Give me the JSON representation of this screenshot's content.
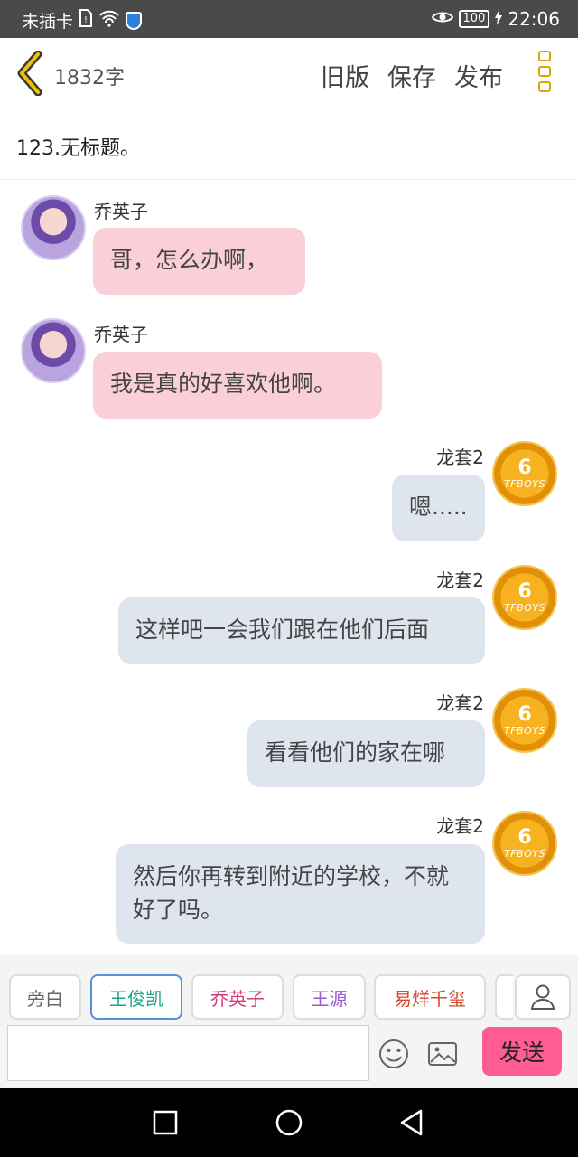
{
  "status_bar": {
    "carrier": "未插卡",
    "battery": "100",
    "time": "22:06"
  },
  "header": {
    "word_count": "1832字",
    "old_version": "旧版",
    "save": "保存",
    "publish": "发布"
  },
  "title": "123.无标题。",
  "messages": [
    {
      "name": "乔英子",
      "text": "哥，怎么办啊，"
    },
    {
      "name": "乔英子",
      "text": "我是真的好喜欢他啊。"
    },
    {
      "name": "龙套2",
      "text": "嗯....."
    },
    {
      "name": "龙套2",
      "text": "这样吧一会我们跟在他们后面"
    },
    {
      "name": "龙套2",
      "text": "看看他们的家在哪"
    },
    {
      "name": "龙套2",
      "text": "然后你再转到附近的学校，不就好了吗。"
    }
  ],
  "avatar": {
    "coin_number": "6",
    "coin_text": "TFBOYS"
  },
  "characters": [
    {
      "label": "旁白",
      "color": "#666666"
    },
    {
      "label": "王俊凯",
      "color": "#1aa58a"
    },
    {
      "label": "乔英子",
      "color": "#d23c78"
    },
    {
      "label": "王源",
      "color": "#9b5bd0"
    },
    {
      "label": "易烊千玺",
      "color": "#d9482b"
    }
  ],
  "input": {
    "placeholder": "",
    "send_label": "发送"
  },
  "icons": {
    "back": "chevron-left-icon",
    "more": "more-vertical-icon",
    "emoji": "smiley-icon",
    "image": "image-icon",
    "person": "person-icon",
    "nav_square": "recent-apps-icon",
    "nav_circle": "home-icon",
    "nav_triangle": "back-triangle-icon"
  },
  "colors": {
    "accent": "#d9a800",
    "pink_bubble": "#fbcfd8",
    "gray_bubble": "#dfe5ee",
    "send": "#ff5c93"
  }
}
